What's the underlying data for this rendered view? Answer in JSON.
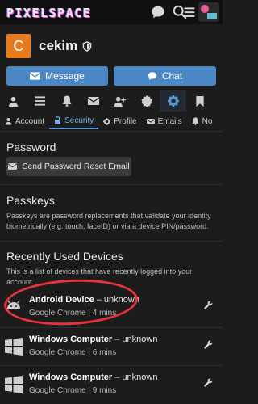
{
  "header": {
    "logo_text": "PIXELSPACE",
    "icons": [
      "chat-icon",
      "search-icon",
      "menu-icon"
    ]
  },
  "profile": {
    "avatar_letter": "C",
    "username": "cekim",
    "avatar_color": "#e87a1e"
  },
  "actions": {
    "message_label": "Message",
    "chat_label": "Chat",
    "accent": "#4c87c5"
  },
  "nav_icons": [
    "user-icon",
    "list-icon",
    "bell-icon",
    "envelope-icon",
    "add-user-icon",
    "badge-icon",
    "gear-icon",
    "bookmark-icon"
  ],
  "tabs": [
    {
      "label": "Account",
      "icon": "person-icon"
    },
    {
      "label": "Security",
      "icon": "lock-icon",
      "active": true
    },
    {
      "label": "Profile",
      "icon": "gear-icon"
    },
    {
      "label": "Emails",
      "icon": "envelope-icon"
    },
    {
      "label": "No",
      "icon": "bell-icon"
    }
  ],
  "password": {
    "title": "Password",
    "reset_button": "Send Password Reset Email"
  },
  "passkeys": {
    "title": "Passkeys",
    "description": "Passkeys are password replacements that validate your identity biometrically (e.g. touch, faceID) or via a device PIN/password."
  },
  "recent": {
    "title": "Recently Used Devices",
    "description": "This is a list of devices that have recently logged into your account.",
    "devices": [
      {
        "name": "Android Device",
        "separator": " – ",
        "status": "unknown",
        "meta": "Google Chrome | 4 mins",
        "os_icon": "android-icon"
      },
      {
        "name": "Windows Computer",
        "separator": " – ",
        "status": "unknown",
        "meta": "Google Chrome | 6 mins",
        "os_icon": "windows-icon"
      },
      {
        "name": "Windows Computer",
        "separator": " – ",
        "status": "unknown",
        "meta": "Google Chrome | 9 mins",
        "os_icon": "windows-icon"
      }
    ]
  },
  "highlight_color": "#e8333c"
}
